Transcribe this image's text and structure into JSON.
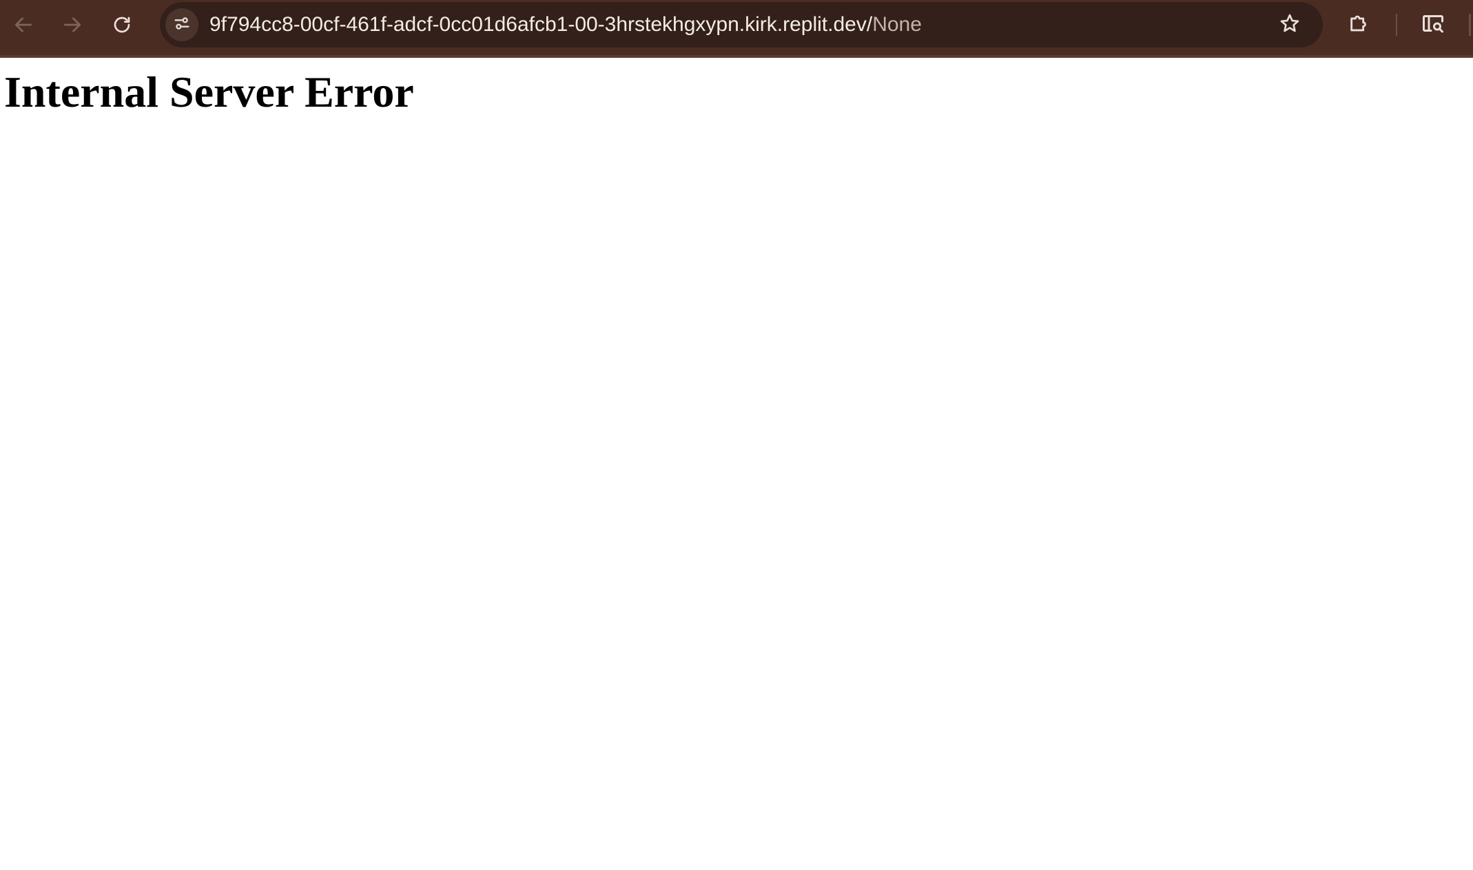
{
  "browser": {
    "url_host": "9f794cc8-00cf-461f-adcf-0cc01d6afcb1-00-3hrstekhgxypn.kirk.replit.dev/",
    "url_path": "None",
    "icons": {
      "back": "arrow-left-icon",
      "forward": "arrow-right-icon",
      "reload": "reload-icon",
      "site_info": "tune-icon",
      "bookmark": "star-icon",
      "extensions": "puzzle-icon",
      "lens": "lens-search-icon"
    },
    "colors": {
      "toolbar": "#4a2c23",
      "omnibox": "#33201a",
      "url_text": "#f4ece8"
    }
  },
  "page": {
    "heading": "Internal Server Error"
  }
}
